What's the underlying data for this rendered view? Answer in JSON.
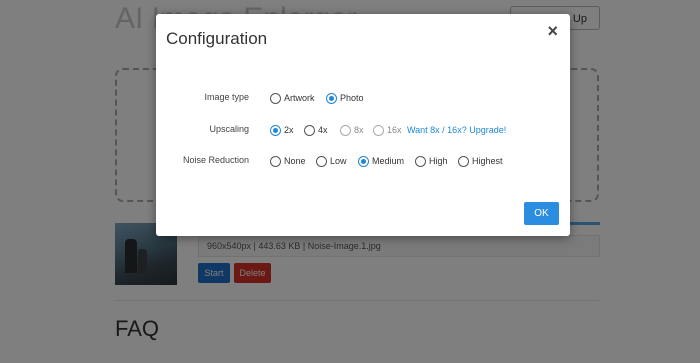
{
  "background": {
    "title": "AI Image Enlarger",
    "signup_label": "Sign Up",
    "file_info": "960x540px | 443.63 KB | Noise-Image.1.jpg",
    "start_label": "Start",
    "delete_label": "Delete",
    "faq_title": "FAQ"
  },
  "modal": {
    "title": "Configuration",
    "close_glyph": "×",
    "ok_label": "OK",
    "image_type": {
      "label": "Image type",
      "options": [
        "Artwork",
        "Photo"
      ],
      "selected": "Photo"
    },
    "upscaling": {
      "label": "Upscaling",
      "options": [
        "2x",
        "4x",
        "8x",
        "16x"
      ],
      "selected": "2x",
      "upgrade_text": "Want 8x / 16x? Upgrade!"
    },
    "noise_reduction": {
      "label": "Noise Reduction",
      "options": [
        "None",
        "Low",
        "Medium",
        "High",
        "Highest"
      ],
      "selected": "Medium"
    }
  },
  "colors": {
    "accent": "#1e87d6",
    "start_button": "#1e73c9",
    "delete_button": "#d9302b"
  }
}
